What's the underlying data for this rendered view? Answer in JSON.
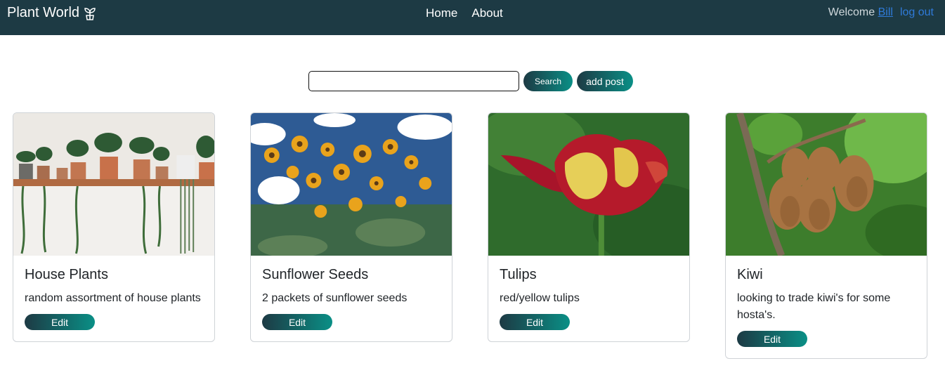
{
  "nav": {
    "brand": "Plant World",
    "brand_icon": "sprout-icon",
    "links": [
      "Home",
      "About"
    ],
    "welcome": "Welcome",
    "user": "Bill",
    "logout": "log out"
  },
  "search": {
    "value": "",
    "placeholder": "",
    "button": "Search",
    "add_post": "add post"
  },
  "cards": [
    {
      "title": "House Plants",
      "text": "random assortment of house plants",
      "edit": "Edit"
    },
    {
      "title": "Sunflower Seeds",
      "text": "2 packets of sunflower seeds",
      "edit": "Edit"
    },
    {
      "title": "Tulips",
      "text": "red/yellow tulips",
      "edit": "Edit"
    },
    {
      "title": "Kiwi",
      "text": "looking to trade kiwi's for some hosta's.",
      "edit": "Edit"
    }
  ],
  "colors": {
    "navbar": "#1d3a44",
    "accent_start": "#1d3a44",
    "accent_end": "#0a8f86",
    "link": "#2f7ad8"
  }
}
